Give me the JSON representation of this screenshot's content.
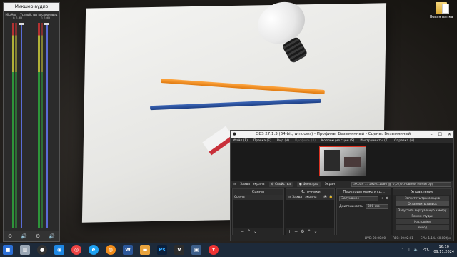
{
  "mixer": {
    "title": "Микшер аудио",
    "channels": [
      {
        "name": "Mic/Aux",
        "value": "0.0 dB"
      },
      {
        "name": "Устройство воспроизвед",
        "value": "0.0 dB"
      }
    ]
  },
  "desktop": {
    "folder_label": "Новая папка"
  },
  "obs": {
    "title": "OBS 27.1.3 (64-bit, windows) - Профиль: Безымянный - Сцены: Безымянный",
    "menu": [
      {
        "label": "Файл (F)",
        "dim": false
      },
      {
        "label": "Правка (E)",
        "dim": false
      },
      {
        "label": "Вид (V)",
        "dim": false
      },
      {
        "label": "Профиль (P)",
        "dim": true
      },
      {
        "label": "Коллекция сцен (S)",
        "dim": false
      },
      {
        "label": "Инструменты (T)",
        "dim": false
      },
      {
        "label": "Справка (H)",
        "dim": false
      }
    ],
    "source_bar": {
      "source_name": "Захват экрана",
      "properties_label": "Свойства",
      "filters_label": "Фильтры",
      "screen_label": "Экран",
      "screen_value": "Экран 1: 1920x1080 @ 0,0 (Основной монитор)"
    },
    "scenes": {
      "header": "Сцены",
      "items": [
        "Сцена"
      ]
    },
    "sources": {
      "header": "Источники",
      "items": [
        "Захват экрана"
      ]
    },
    "transitions": {
      "header": "Переходы между сц...",
      "selected": "Затухание",
      "duration_label": "Длительность",
      "duration_value": "300 ms"
    },
    "controls": {
      "header": "Управление",
      "buttons": [
        "Запустить трансляцию",
        "Остановить запись",
        "Запустить виртуальную камеру",
        "Режим студии",
        "Настройки",
        "Выход"
      ]
    },
    "status": {
      "live": "LIVE: 00:00:00",
      "rec": "REC: 00:02:01",
      "cpu": "CPU: 1.1%, 60.00 fps"
    }
  },
  "taskbar": {
    "language": "РУС",
    "time": "16:10",
    "date": "09.11.2024"
  }
}
